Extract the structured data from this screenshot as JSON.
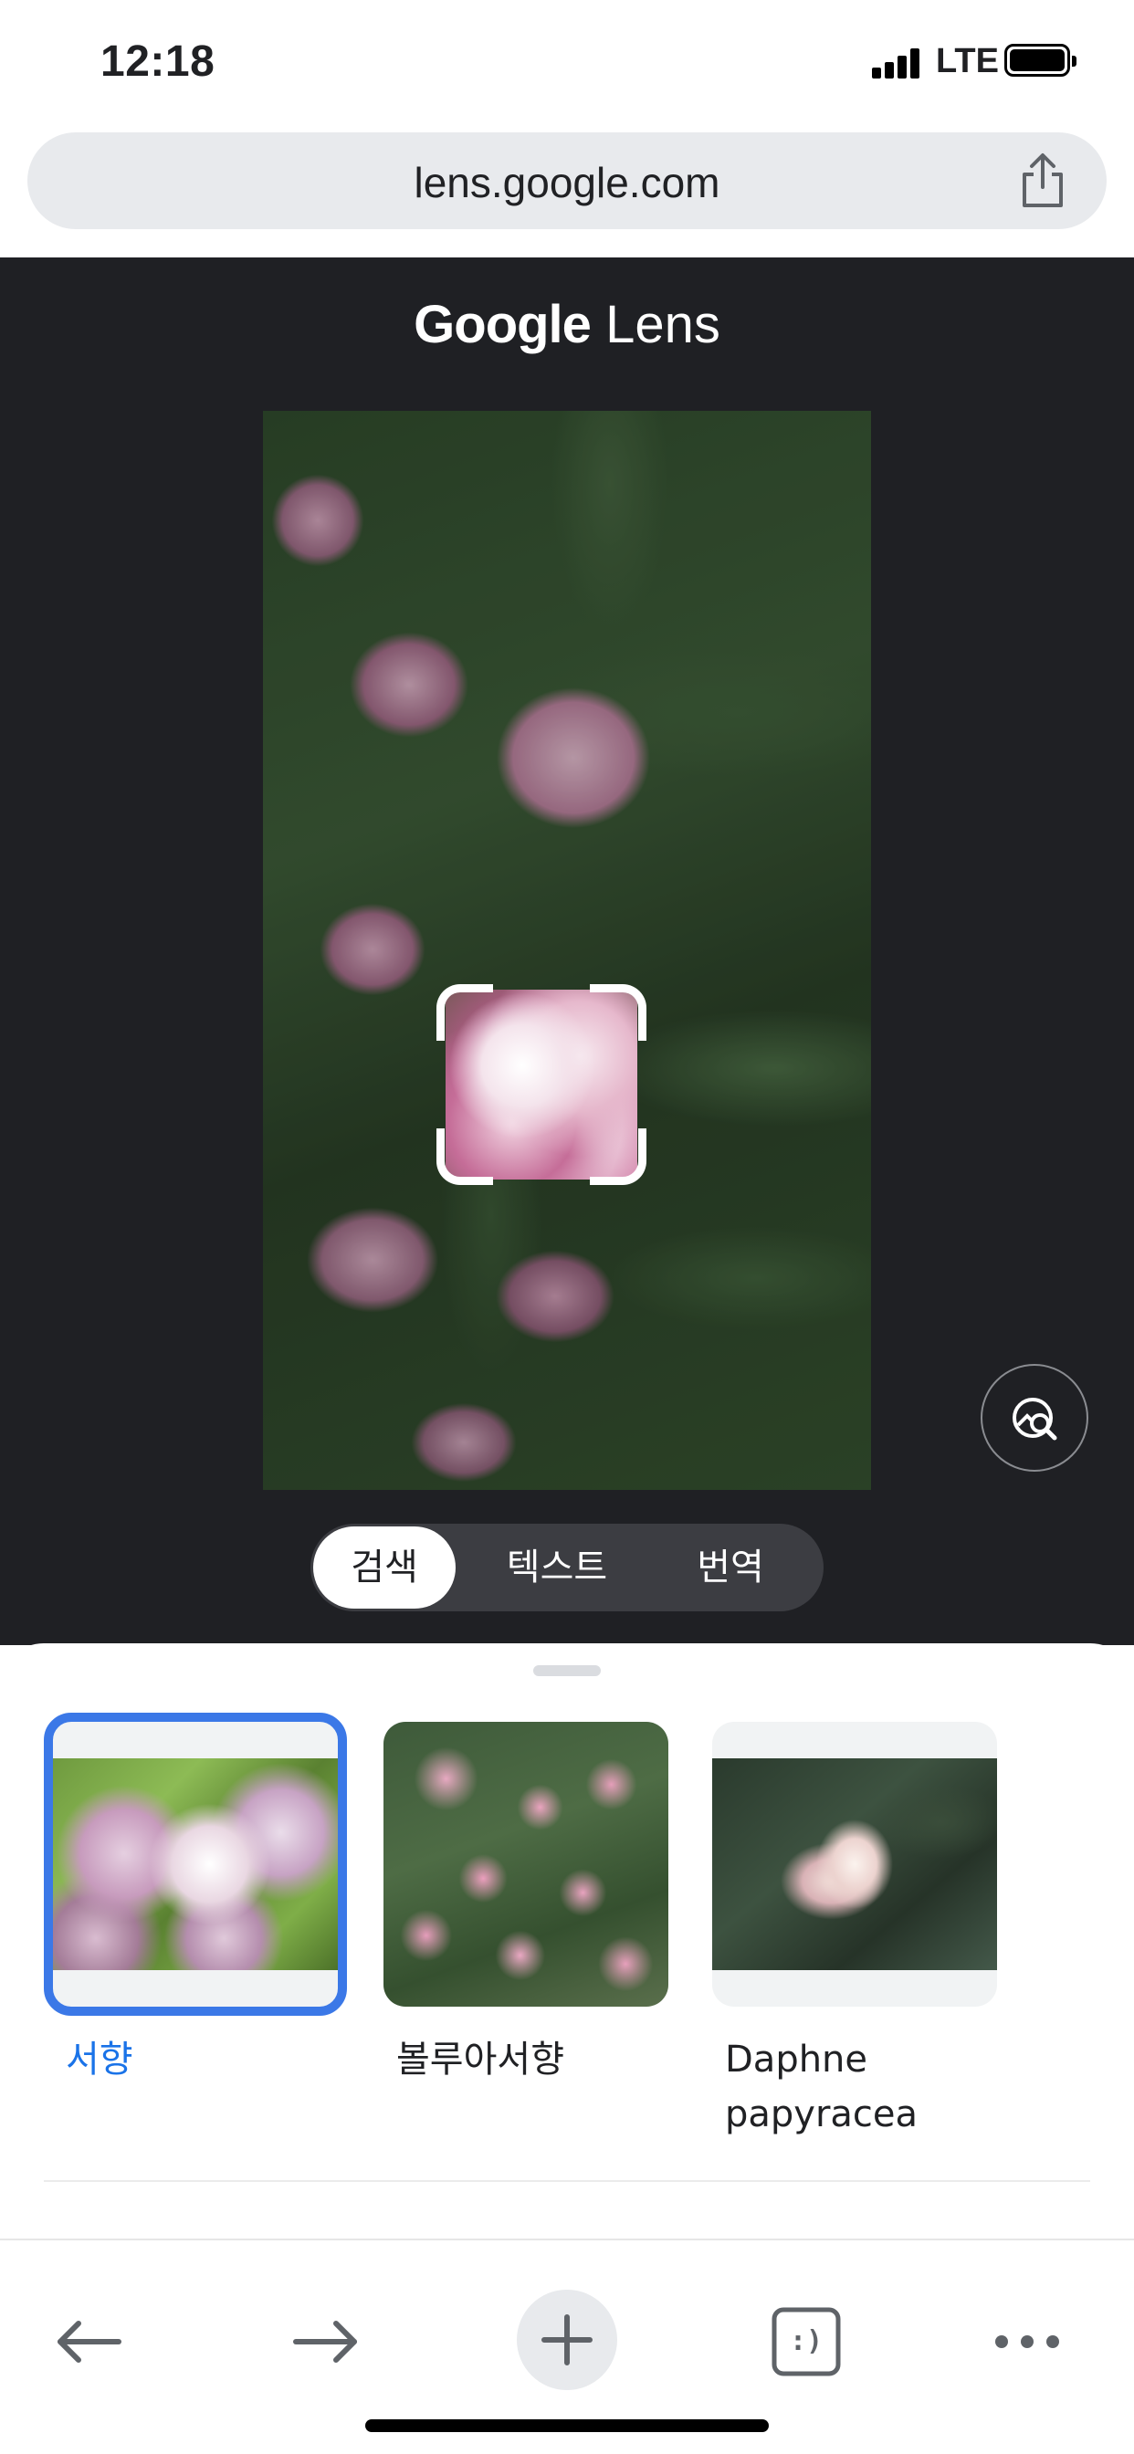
{
  "status_bar": {
    "time": "12:18",
    "network": "LTE"
  },
  "url_bar": {
    "url": "lens.google.com",
    "share_icon": "share-icon"
  },
  "lens": {
    "title_brand": "Google",
    "title_product": "Lens",
    "search_image_icon": "image-search-icon",
    "modes": [
      {
        "label": "검색",
        "active": true
      },
      {
        "label": "텍스트",
        "active": false
      },
      {
        "label": "번역",
        "active": false
      }
    ]
  },
  "results": [
    {
      "label": "서향",
      "selected": true
    },
    {
      "label": "볼루아서향",
      "selected": false
    },
    {
      "label": "Daphne papyracea",
      "selected": false
    }
  ],
  "toolbar": {
    "back_icon": "back-arrow-icon",
    "forward_icon": "forward-arrow-icon",
    "new_tab_icon": "plus-icon",
    "tabs_label": ":)",
    "more_icon": "more-horizontal-icon"
  },
  "colors": {
    "lens_background": "#1f2024",
    "selected_accent": "#1a73e8",
    "url_bar_bg": "#e8eaed"
  }
}
